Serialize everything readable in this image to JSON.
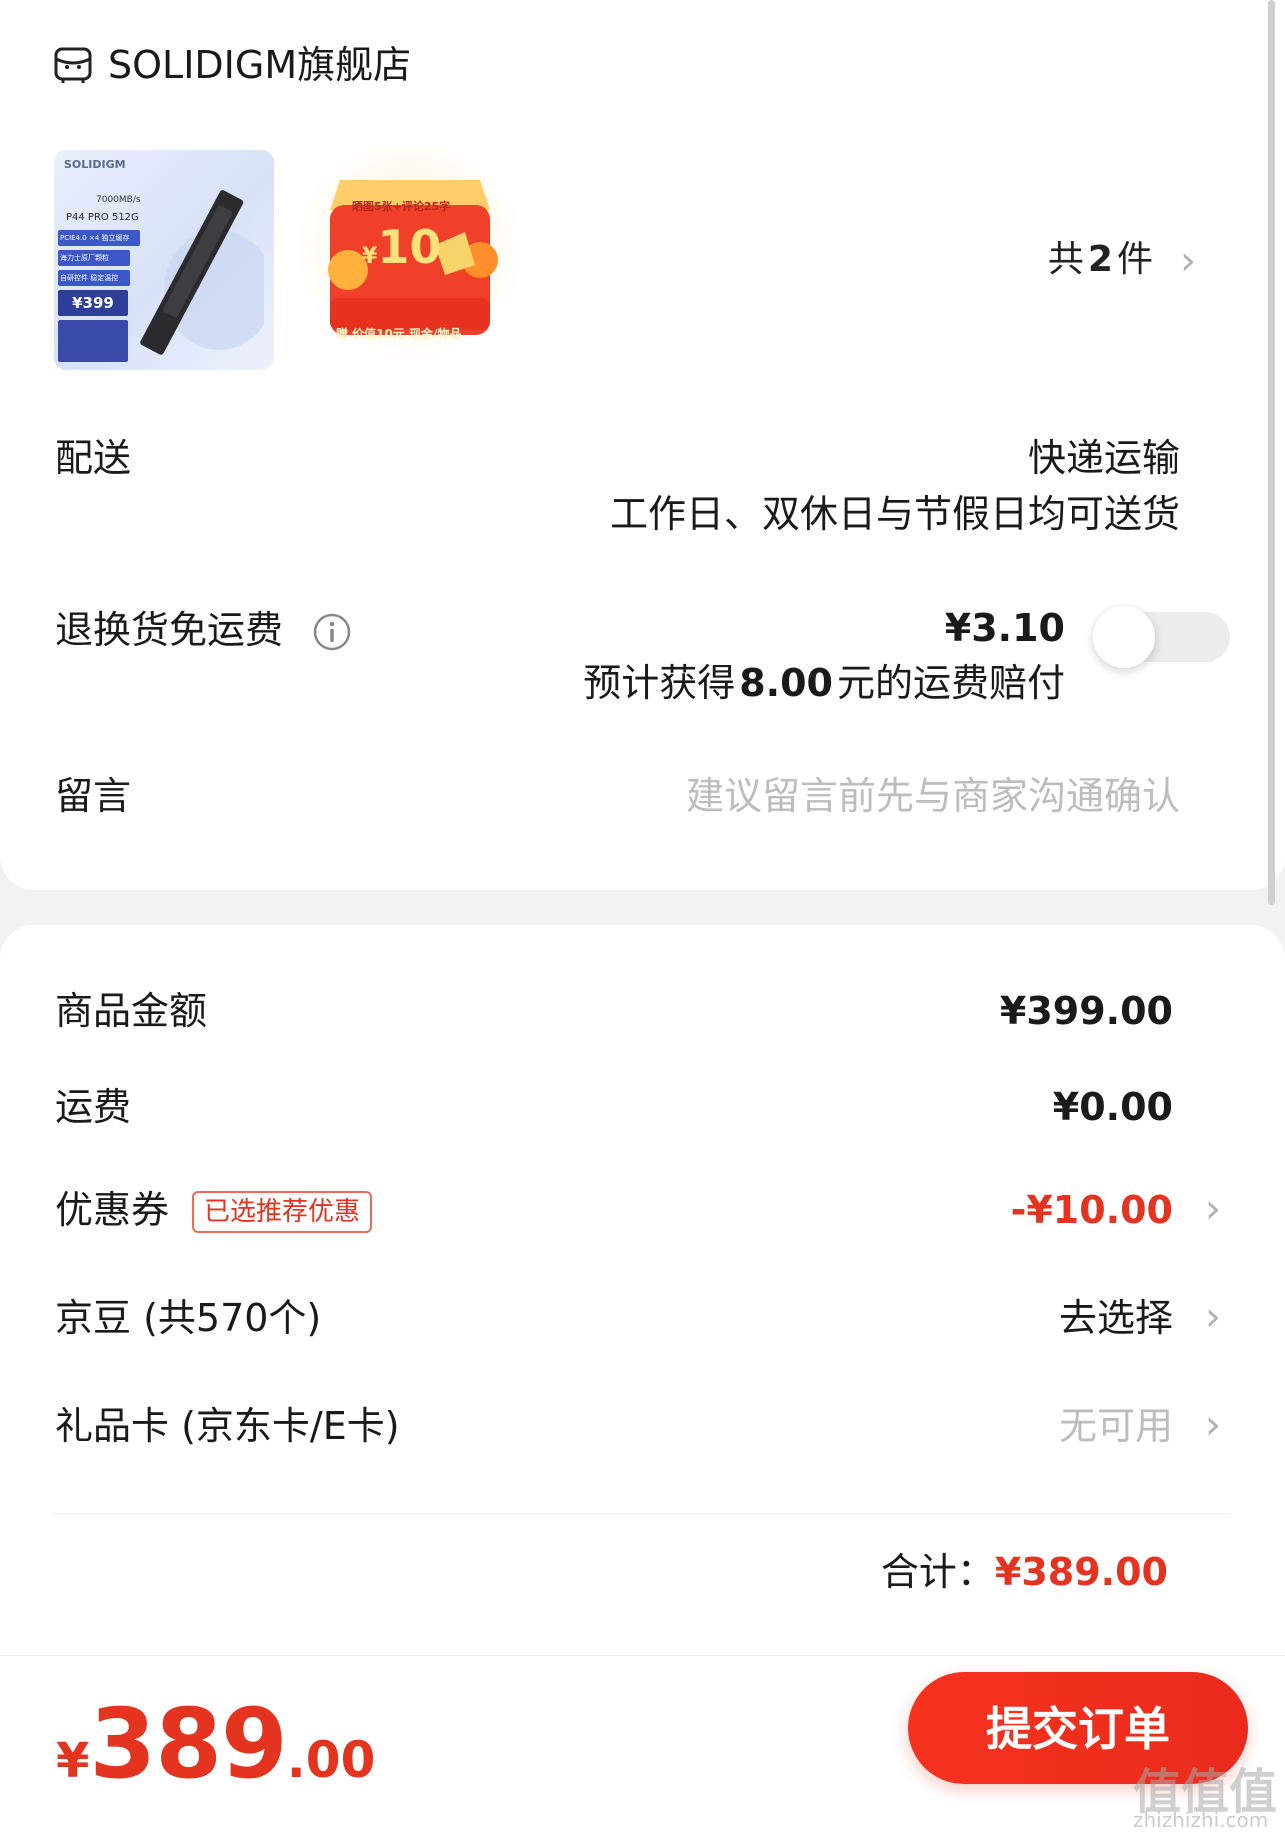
{
  "store": {
    "name": "SOLIDIGM旗舰店"
  },
  "products": {
    "ssd_thumb": {
      "brand": "SOLIDIGM",
      "model": "P44 PRO 512G",
      "speed": "7000MB/s",
      "feature_lines": [
        "PCIE4.0 ×4 独立缓存",
        "海力士原厂颗粒",
        "自研控件 稳定温控"
      ],
      "price": "¥399"
    },
    "gift_thumb": {
      "top_text": "晒图5张+评论25字",
      "amount": "10",
      "currency": "¥",
      "bottom_text": "赠 价值10元 现金/物品"
    },
    "count_prefix": "共",
    "count": "2",
    "count_suffix": "件"
  },
  "delivery": {
    "label": "配送",
    "method": "快递运输",
    "schedule": "工作日、双休日与节假日均可送货"
  },
  "return_shipping": {
    "label": "退换货免运费",
    "price": "¥3.10",
    "compensation_prefix": "预计获得",
    "compensation_amount": "8.00",
    "compensation_suffix": "元的运费赔付",
    "toggle_on": false
  },
  "message": {
    "label": "留言",
    "placeholder": "建议留言前先与商家沟通确认"
  },
  "summary": {
    "goods_label": "商品金额",
    "goods_value": "¥399.00",
    "shipping_label": "运费",
    "shipping_value": "¥0.00",
    "coupon_label": "优惠券",
    "coupon_badge": "已选推荐优惠",
    "coupon_value": "-¥10.00",
    "beans_label": "京豆 (共570个)",
    "beans_value": "去选择",
    "giftcard_label": "礼品卡 (京东卡/E卡)",
    "giftcard_value": "无可用",
    "total_label": "合计：",
    "total_value": "¥389.00"
  },
  "bottom": {
    "currency": "¥",
    "amount_int": "389",
    "amount_dec": ".00",
    "submit_label": "提交订单"
  },
  "watermark": {
    "text": "值值值",
    "url": "zhizhizhi.com"
  },
  "colors": {
    "accent": "#e4331f",
    "button": "#f5321e",
    "text": "#1a1a1a",
    "muted": "#bdbdbd"
  }
}
